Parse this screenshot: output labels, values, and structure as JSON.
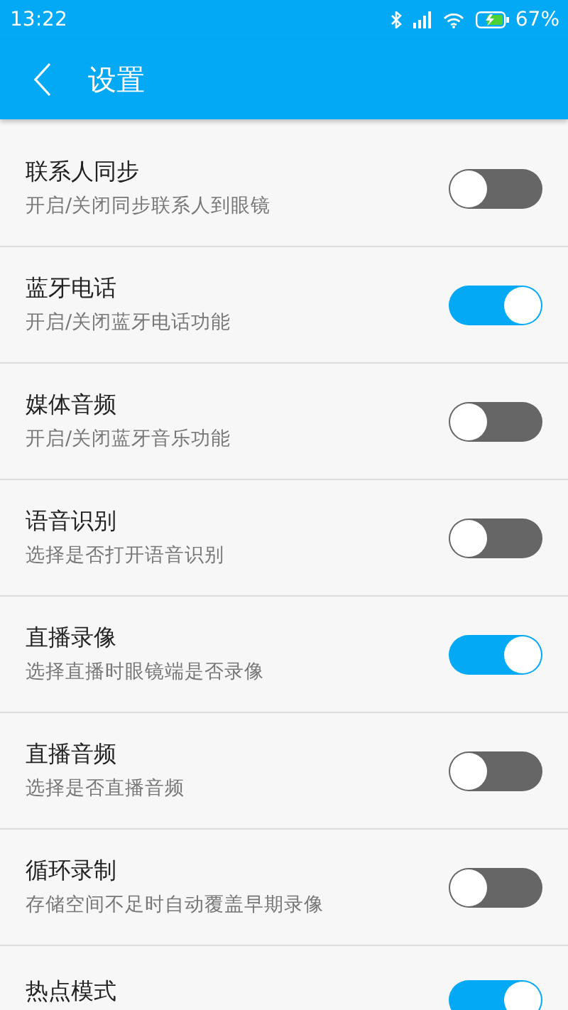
{
  "status_bar": {
    "time": "13:22",
    "battery": "67%"
  },
  "app_bar": {
    "title": "设置"
  },
  "settings": [
    {
      "title": "联系人同步",
      "subtitle": "开启/关闭同步联系人到眼镜",
      "on": false
    },
    {
      "title": "蓝牙电话",
      "subtitle": "开启/关闭蓝牙电话功能",
      "on": true
    },
    {
      "title": "媒体音频",
      "subtitle": "开启/关闭蓝牙音乐功能",
      "on": false
    },
    {
      "title": "语音识别",
      "subtitle": "选择是否打开语音识别",
      "on": false
    },
    {
      "title": "直播录像",
      "subtitle": "选择直播时眼镜端是否录像",
      "on": true
    },
    {
      "title": "直播音频",
      "subtitle": "选择是否直播音频",
      "on": false
    },
    {
      "title": "循环录制",
      "subtitle": "存储空间不足时自动覆盖早期录像",
      "on": false
    },
    {
      "title": "热点模式",
      "on": true
    }
  ]
}
